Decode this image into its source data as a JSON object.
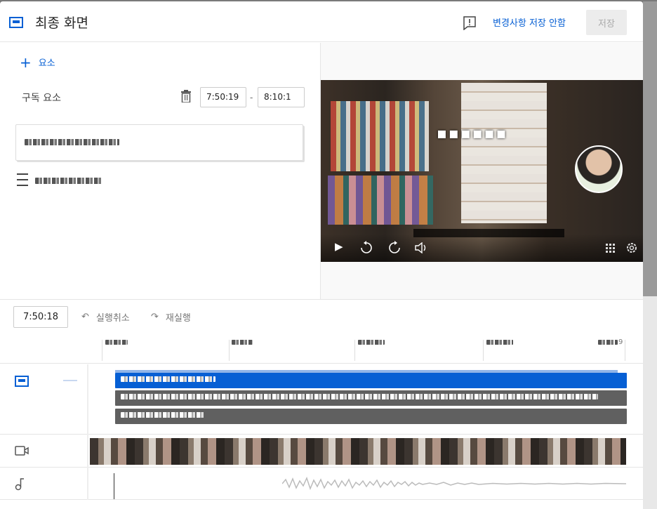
{
  "header": {
    "title": "최종 화면",
    "discard_label": "변경사항 저장 안함",
    "save_label": "저장"
  },
  "editor": {
    "add_element_label": "요소",
    "subscribe_label": "구독 요소",
    "start_time": "7:50:19",
    "end_time": "8:10:1",
    "range_separator": "-"
  },
  "toolbar": {
    "current_time": "7:50:18",
    "undo_label": "실행취소",
    "redo_label": "재실행"
  },
  "ruler": {
    "end_label": "9"
  },
  "colors": {
    "accent": "#065fd4",
    "clip_selected": "#065fd4",
    "clip_default": "#606060",
    "save_disabled_bg": "#ececec"
  },
  "icons": [
    "end-screen-icon",
    "feedback-icon",
    "plus-icon",
    "trash-icon",
    "list-icon",
    "play-icon",
    "rewind-10-icon",
    "forward-10-icon",
    "volume-icon",
    "grid-icon",
    "settings-icon",
    "undo-icon",
    "redo-icon",
    "video-track-icon",
    "audio-track-icon"
  ]
}
